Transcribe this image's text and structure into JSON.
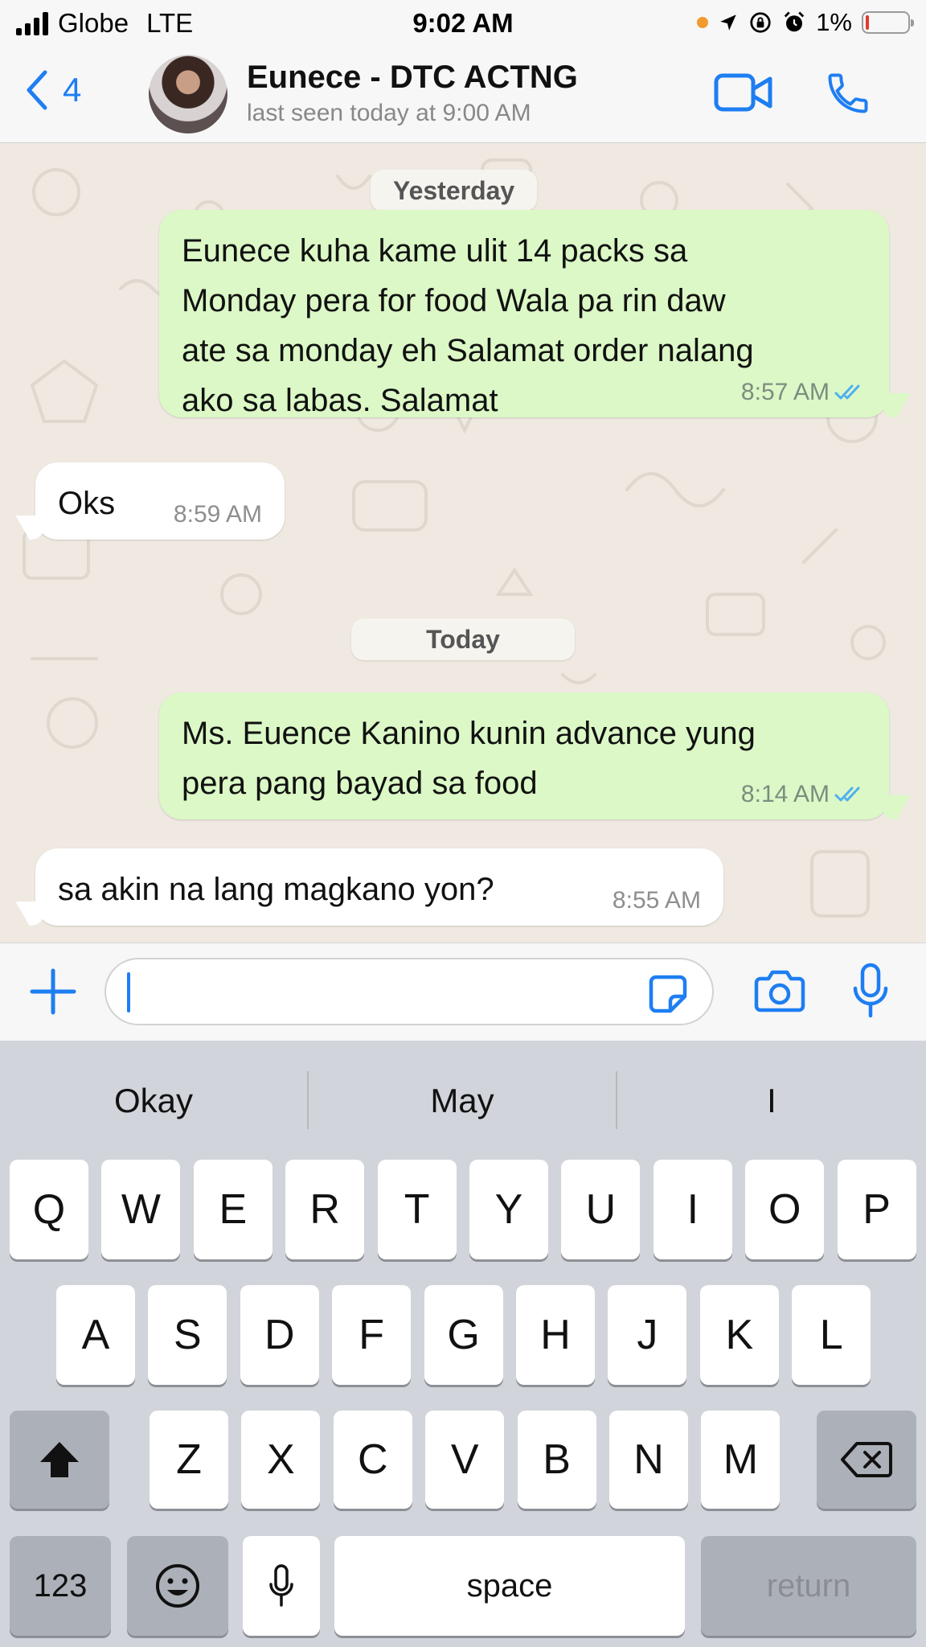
{
  "status_bar": {
    "carrier": "Globe",
    "network": "LTE",
    "time": "9:02 AM",
    "battery": "1%",
    "battery_level": 0.01
  },
  "header": {
    "back_count": "4",
    "contact_name": "Eunece - DTC ACTNG",
    "last_seen": "last seen today at 9:00 AM"
  },
  "chat": {
    "date_yesterday": "Yesterday",
    "date_today": "Today",
    "messages": [
      {
        "direction": "out",
        "lines": [
          "Eunece kuha kame ulit 14 packs sa",
          "Monday pera for food Wala pa rin daw",
          "ate sa monday eh Salamat order nalang",
          "ako sa labas. Salamat"
        ],
        "time": "8:57 AM"
      },
      {
        "direction": "in",
        "lines": [
          "Oks"
        ],
        "time": "8:59 AM"
      },
      {
        "direction": "out",
        "lines": [
          "Ms. Euence Kanino kunin advance yung",
          "pera pang bayad sa food"
        ],
        "time": "8:14 AM"
      },
      {
        "direction": "in",
        "lines": [
          "sa akin na lang magkano yon?"
        ],
        "time": "8:55 AM"
      }
    ]
  },
  "keyboard": {
    "suggestions": [
      "Okay",
      "May",
      "I"
    ],
    "row1": [
      "Q",
      "W",
      "E",
      "R",
      "T",
      "Y",
      "U",
      "I",
      "O",
      "P"
    ],
    "row2": [
      "A",
      "S",
      "D",
      "F",
      "G",
      "H",
      "J",
      "K",
      "L"
    ],
    "row3": [
      "Z",
      "X",
      "C",
      "V",
      "B",
      "N",
      "M"
    ],
    "numbers_key": "123",
    "space_key": "space",
    "return_key": "return"
  },
  "colors": {
    "accent": "#1e7ef2",
    "outgoing_bubble": "#dbf8c6",
    "incoming_bubble": "#ffffff",
    "read_ticks": "#4fb0f0"
  }
}
